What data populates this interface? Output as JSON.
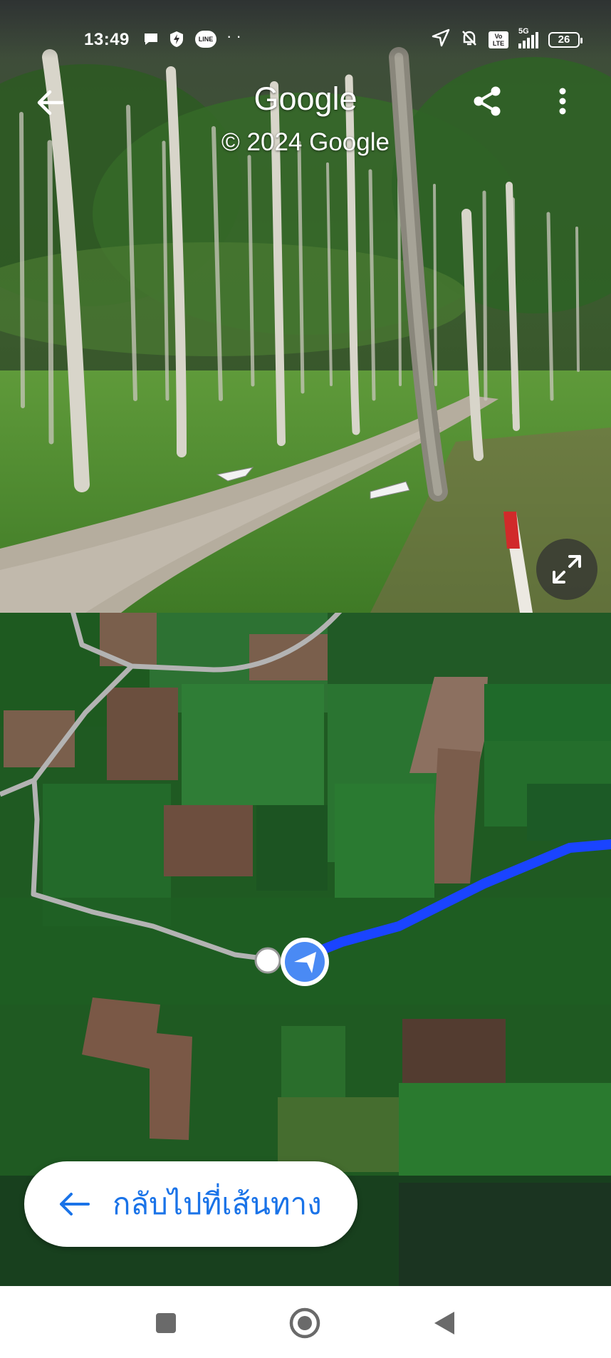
{
  "status_bar": {
    "time": "13:49",
    "left_icons": [
      "chat-bubble-icon",
      "shield-bolt-icon",
      "line-app-icon"
    ],
    "line_label": "LINE",
    "volte_label": "Vo LTE",
    "network_label": "5G",
    "battery_level": "26"
  },
  "street_view": {
    "title": "Google",
    "copyright": "© 2024 Google"
  },
  "map": {
    "route_color": "#1a44ff",
    "road_color": "#b3b3b3",
    "location_color": "#4a8af4",
    "back_to_route_label": "กลับไปที่เส้นทาง"
  },
  "nav_bar": {
    "buttons": [
      "recents-icon",
      "home-icon",
      "back-icon"
    ]
  }
}
